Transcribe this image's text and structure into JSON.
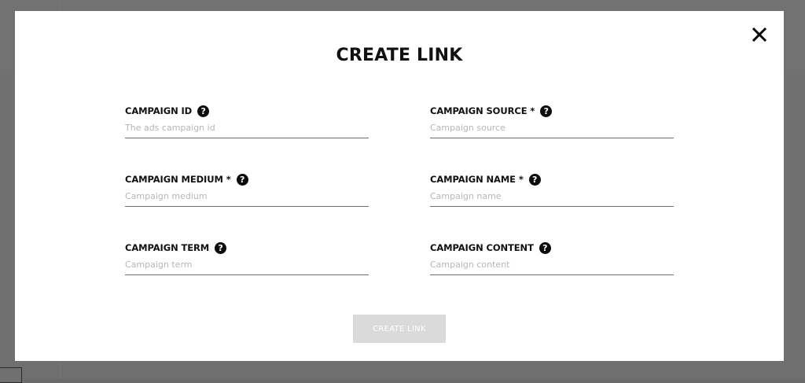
{
  "modal": {
    "title": "CREATE LINK",
    "close_icon": "close-icon",
    "submit_label": "CREATE LINK",
    "help_icon_glyph": "?"
  },
  "fields": [
    {
      "label": "CAMPAIGN ID",
      "placeholder": "The ads campaign id",
      "value": ""
    },
    {
      "label": "CAMPAIGN SOURCE *",
      "placeholder": "Campaign source",
      "value": ""
    },
    {
      "label": "CAMPAIGN MEDIUM *",
      "placeholder": "Campaign medium",
      "value": ""
    },
    {
      "label": "CAMPAIGN NAME *",
      "placeholder": "Campaign name",
      "value": ""
    },
    {
      "label": "CAMPAIGN TERM",
      "placeholder": "Campaign term",
      "value": ""
    },
    {
      "label": "CAMPAIGN CONTENT",
      "placeholder": "Campaign content",
      "value": ""
    }
  ],
  "colors": {
    "overlay": "#6f6f6f",
    "modal_bg": "#ffffff",
    "disabled_button": "#dadada",
    "text": "#111111"
  }
}
